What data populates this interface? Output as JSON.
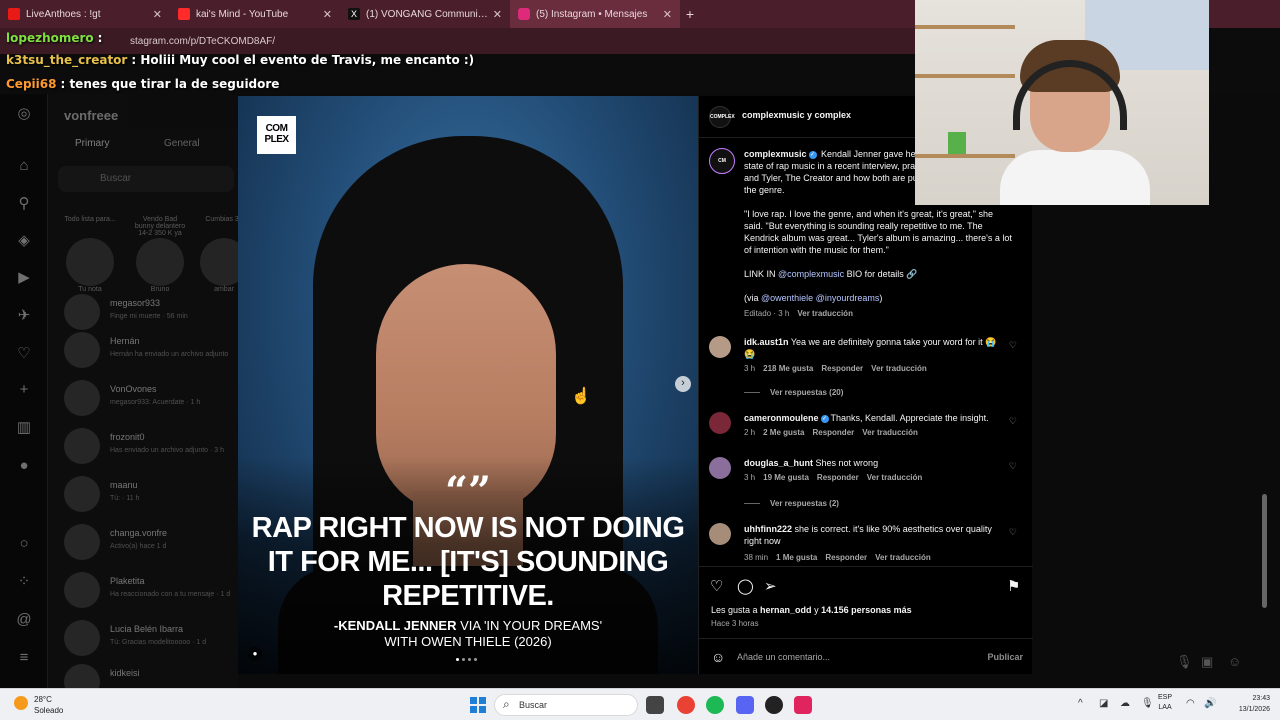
{
  "browser": {
    "tabs": [
      {
        "title": "LiveAnthoes : !gt",
        "color": "#e91916"
      },
      {
        "title": "kai's Mind - YouTube",
        "color": "#ff2a2a"
      },
      {
        "title": "(1) VONGANG Community / X",
        "color": "#111111"
      },
      {
        "title": "(5) Instagram • Mensajes",
        "color": "#dd2a7b"
      }
    ],
    "url_fragment": "stagram.com/p/DTeCKOMD8AF/"
  },
  "stream_chat": [
    {
      "user": "lopezhomero",
      "message": ":",
      "user_color": "#7fe040"
    },
    {
      "user": "k3tsu_the_creator",
      "message": ": Holiii  Muy cool el evento de Travis, me encanto :)",
      "user_color": "#e8c04a"
    },
    {
      "user": "Cepii68",
      "message": ": tenes que tirar la de seguidore",
      "user_color": "#ff9a2e"
    }
  ],
  "dm_sidebar": {
    "username": "vonfreee",
    "tabs": [
      "Primary",
      "General"
    ],
    "search_placeholder": "Buscar",
    "notes": [
      {
        "text": "Todo lista para...",
        "name": "Tu nota"
      },
      {
        "text": "Vendo Bad bunny delantero 14-2 350 K ya",
        "name": "Bruno"
      },
      {
        "text": "Cumbias 33",
        "name": "ambar"
      }
    ],
    "conversations": [
      {
        "name": "megasor933",
        "sub": "Finge mi muerte · 56 min"
      },
      {
        "name": "Hernán",
        "sub": "Hernán ha enviado un archivo adjunto"
      },
      {
        "name": "VonOvones",
        "sub": "megasor933: Acuerdate · 1 h"
      },
      {
        "name": "frozonit0",
        "sub": "Has enviado un archivo adjunto · 3 h"
      },
      {
        "name": "maanu",
        "sub": "Tú: · 11 h"
      },
      {
        "name": "changa.vonfre",
        "sub": "Activo(a) hace 1 d"
      },
      {
        "name": "Plaketita",
        "sub": "Ha reaccionado con a tu mensaje · 1 d"
      },
      {
        "name": "Lucia Belén Ibarra",
        "sub": "Tú: Gracias modelitooooo · 1 d"
      },
      {
        "name": "kidkeisi",
        "sub": ""
      }
    ]
  },
  "post": {
    "brand_logo": "COM PLEX",
    "quote_mark": "“”",
    "headline": "RAP RIGHT NOW IS NOT DOING IT FOR ME... [IT'S] SOUNDING REPETITIVE.",
    "attribution_name": "-KENDALL JENNER",
    "attribution_rest": " VIA 'IN YOUR DREAMS'",
    "attribution_line2": "WITH OWEN THIELE (2026)",
    "header_name": "complexmusic y complex",
    "avatar_label": "COMPLEX",
    "caption": {
      "user": "complexmusic",
      "p1": " Kendall Jenner gave her thoughts on the current state of rap music in a recent interview, praising Kendrick Lamar and Tyler, The Creator and how both are pushing boundaries for the genre.",
      "p2": "\"I love rap. I love the genre, and when it's great, it's great,\" she said. \"But everything is sounding really repetitive to me. The Kendrick album was great... Tyler's album is amazing... there's a lot of intention with the music for them.\"",
      "p3_pre": "LINK IN ",
      "p3_link": "@complexmusic",
      "p3_post": " BIO for details 🔗",
      "p4_pre": "(via ",
      "p4_link": "@owenthiele @inyourdreams",
      "p4_post": ")",
      "meta_edited": "Editado · 3 h",
      "meta_translate": "Ver traducción"
    },
    "comments": [
      {
        "user": "idk.aust1n",
        "text": "Yea we are definitely gonna take your word for it 😭😭",
        "time": "3 h",
        "likes": "218 Me gusta",
        "reply": "Responder",
        "translate": "Ver traducción",
        "replies": "Ver respuestas (20)",
        "avatar_color": "#b59a88"
      },
      {
        "user": "cameronmoulene",
        "text": "Thanks, Kendall. Appreciate the insight.",
        "time": "2 h",
        "likes": "2 Me gusta",
        "reply": "Responder",
        "translate": "Ver traducción",
        "replies": "",
        "avatar_color": "#7a2838"
      },
      {
        "user": "douglas_a_hunt",
        "text": "Shes not wrong",
        "time": "3 h",
        "likes": "19 Me gusta",
        "reply": "Responder",
        "translate": "Ver traducción",
        "replies": "Ver respuestas (2)",
        "avatar_color": "#8a6e9c"
      },
      {
        "user": "uhhfinn222",
        "text": "she is correct. it's like 90% aesthetics over quality right now",
        "time": "38 min",
        "likes": "1 Me gusta",
        "reply": "Responder",
        "translate": "Ver traducción",
        "replies": "",
        "avatar_color": "#a58d7a"
      }
    ],
    "likes_prefix": "Les gusta a ",
    "likes_user": "hernan_odd",
    "likes_mid": " y ",
    "likes_count": "14.156 personas más",
    "time_ago": "Hace 3 horas",
    "comment_placeholder": "Añade un comentario...",
    "publish": "Publicar"
  },
  "taskbar": {
    "temperature": "28°C",
    "condition": "Soleado",
    "search": "Buscar",
    "lang1": "ESP",
    "lang2": "LAA",
    "time": "23:43",
    "date": "13/1/2026"
  }
}
